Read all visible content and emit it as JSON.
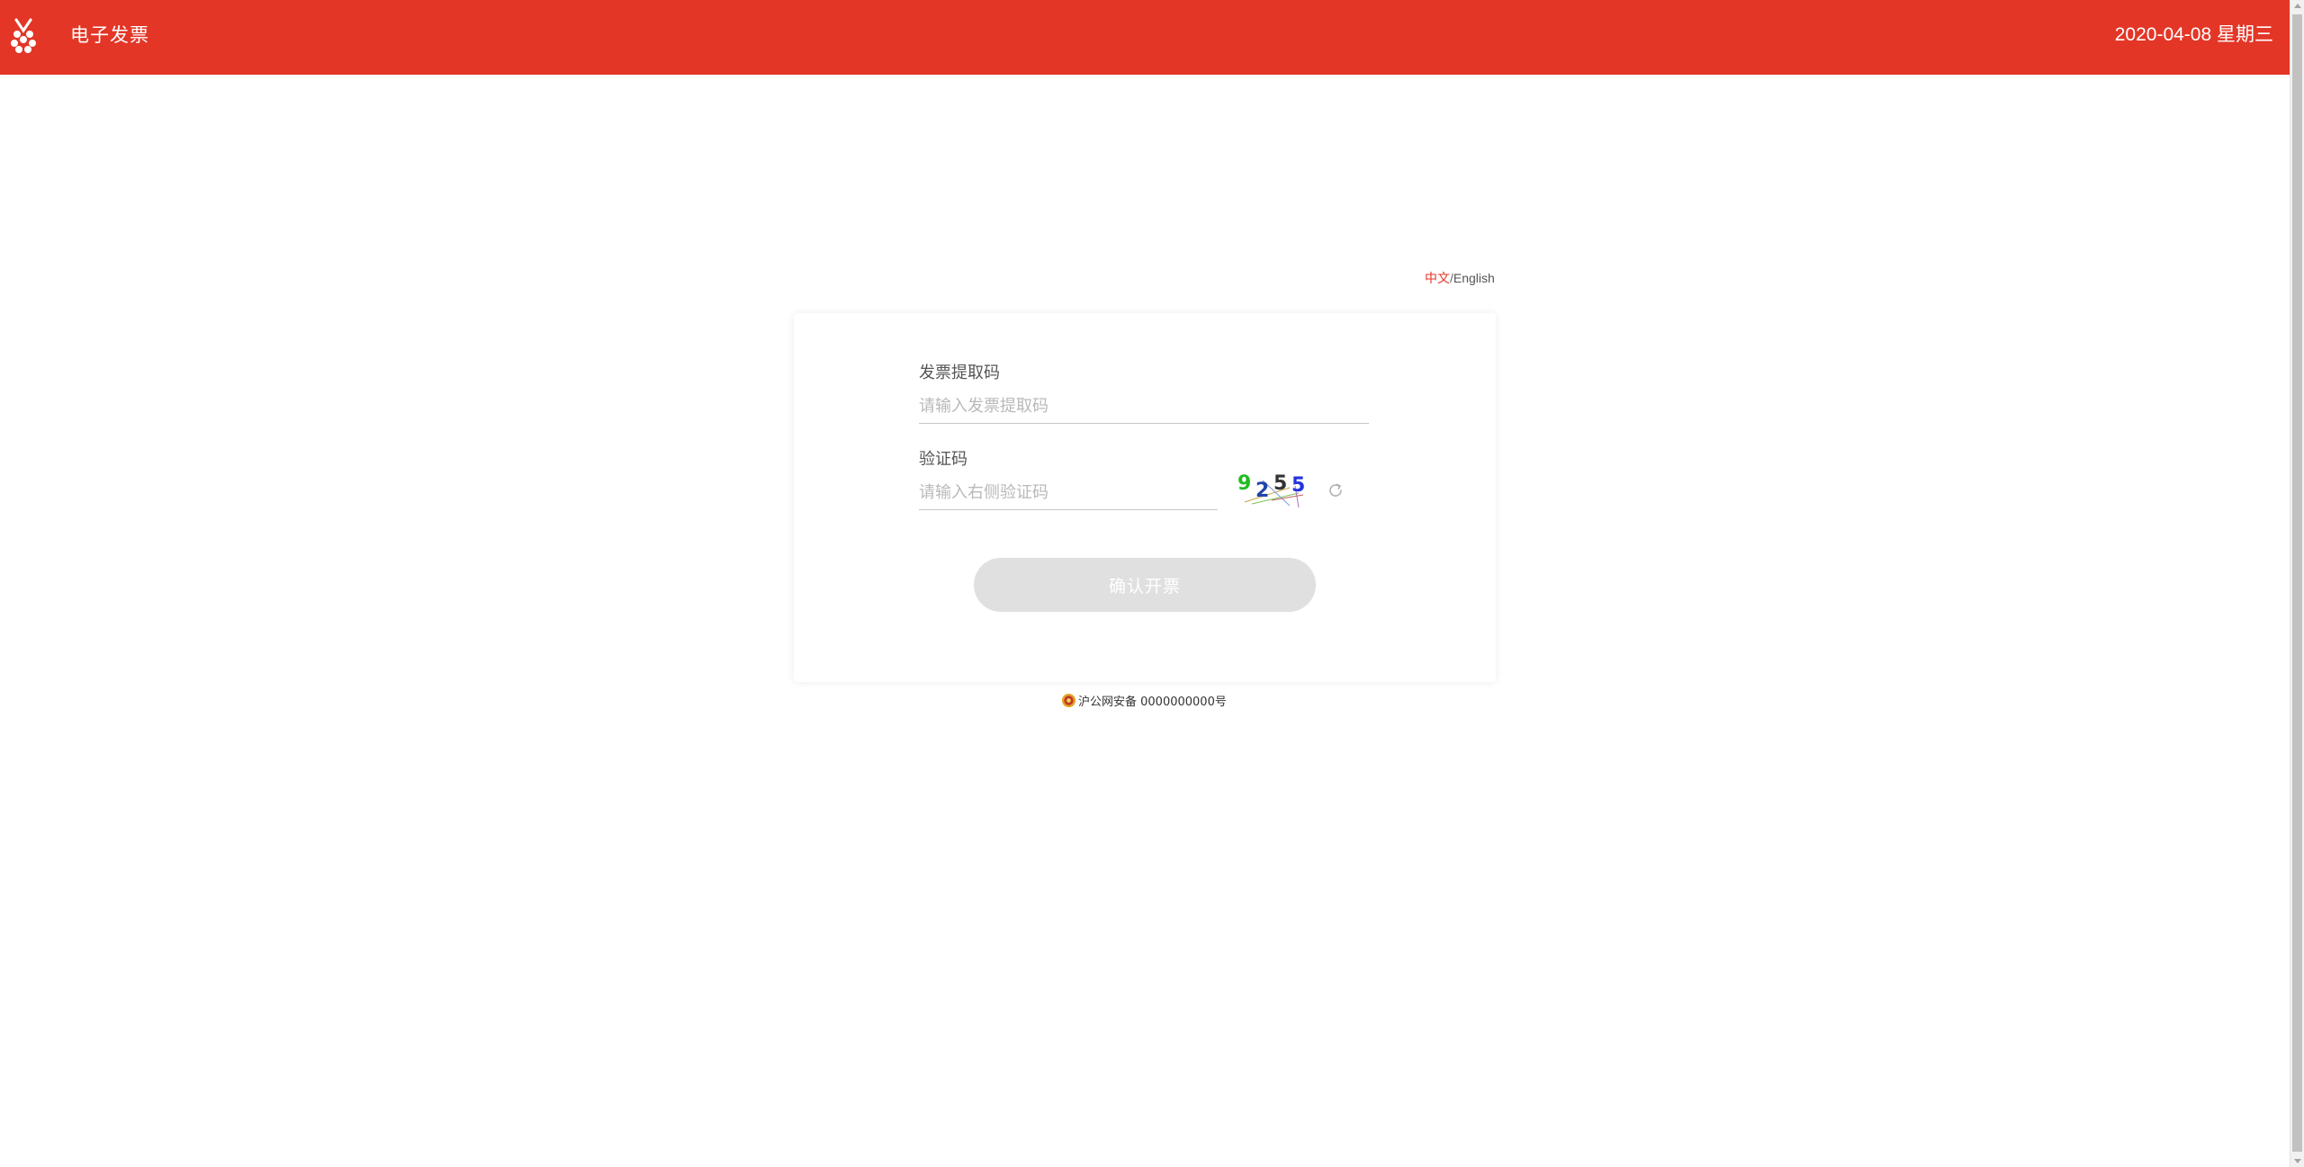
{
  "header": {
    "title": "电子发票",
    "date": "2020-04-08 星期三"
  },
  "language": {
    "zh": "中文",
    "separator": "/",
    "en": "English"
  },
  "form": {
    "code_label": "发票提取码",
    "code_placeholder": "请输入发票提取码",
    "code_value": "",
    "captcha_label": "验证码",
    "captcha_placeholder": "请输入右侧验证码",
    "captcha_value": "",
    "captcha_digits": [
      "9",
      "2",
      "5",
      "5"
    ],
    "submit_label": "确认开票"
  },
  "footer": {
    "icp_text": "沪公网安备 0000000000号"
  },
  "colors": {
    "brand": "#e33627",
    "button_disabled": "#e0e0e0"
  },
  "icons": {
    "logo": "logo-icon",
    "refresh": "refresh-icon",
    "police": "police-badge-icon"
  }
}
